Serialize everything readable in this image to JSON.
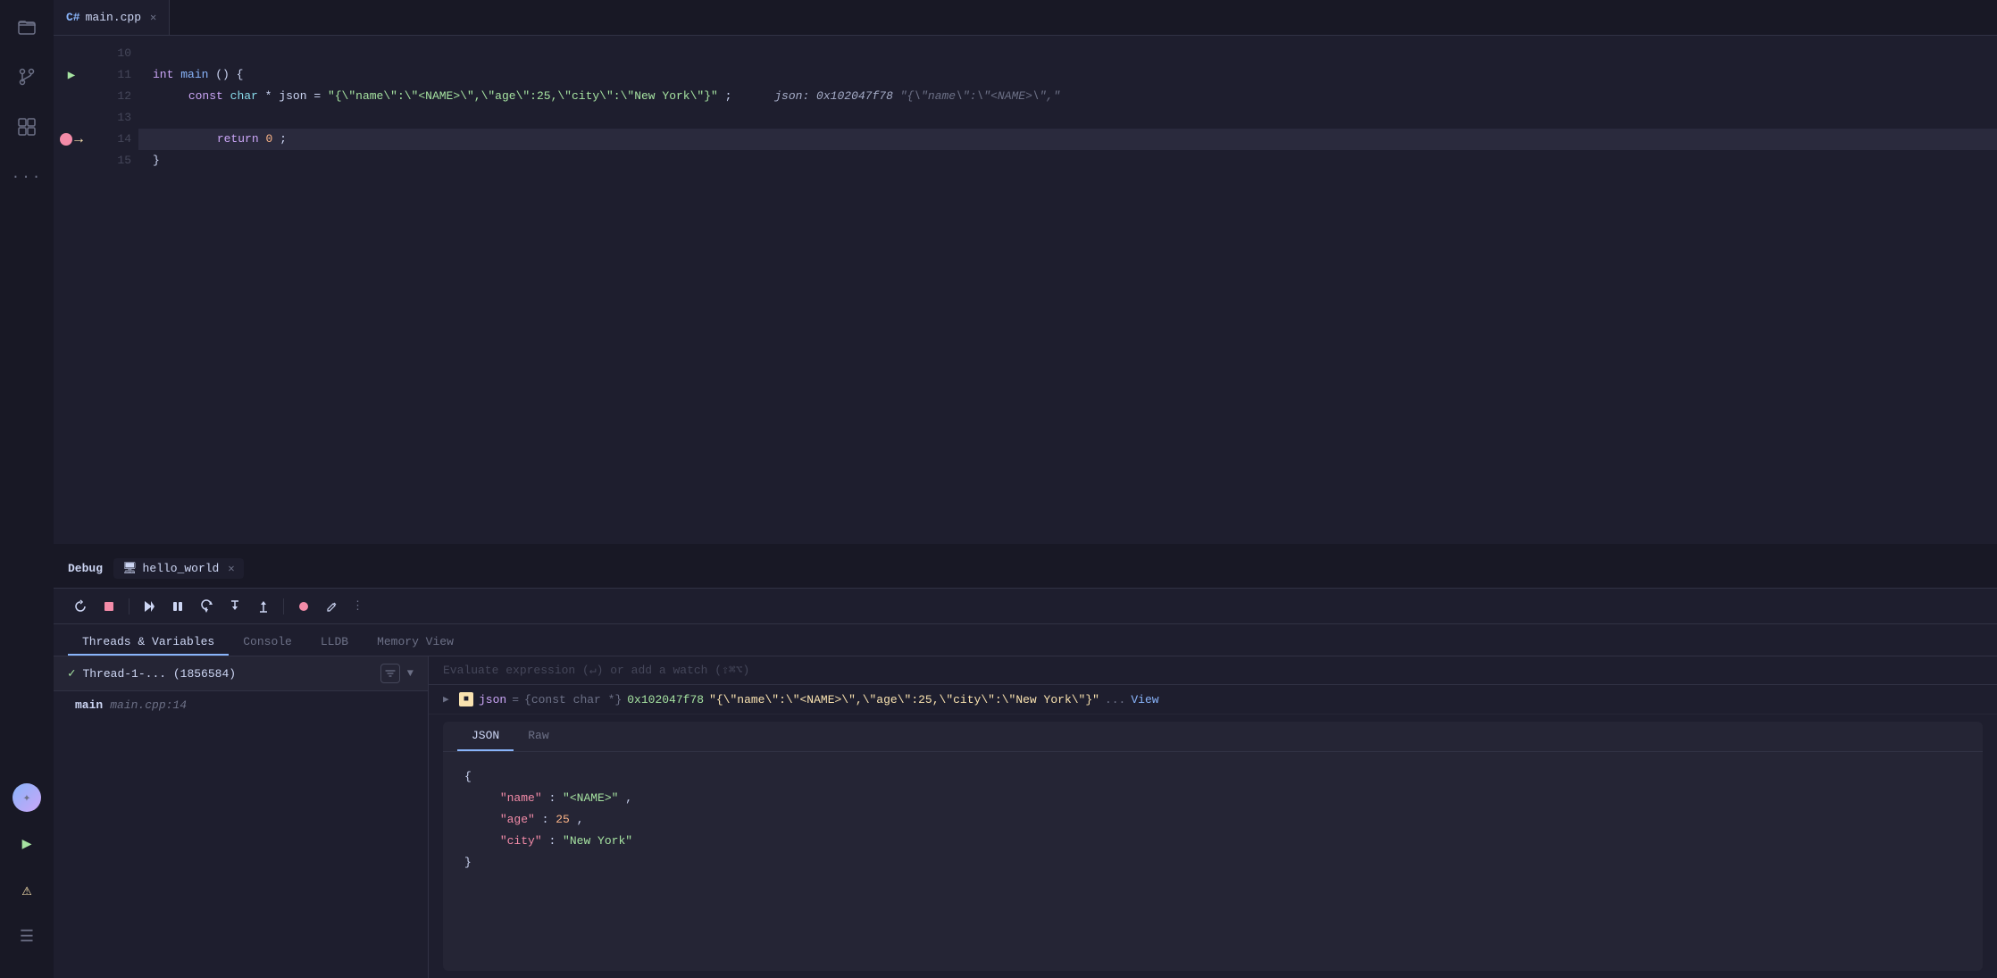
{
  "sidebar": {
    "icons": [
      {
        "name": "folder-icon",
        "symbol": "🗂",
        "active": false
      },
      {
        "name": "source-control-icon",
        "symbol": "⎇",
        "active": false
      },
      {
        "name": "extensions-icon",
        "symbol": "⊞",
        "active": false
      },
      {
        "name": "more-icon",
        "symbol": "···",
        "active": false
      }
    ],
    "bottom": [
      {
        "name": "run-icon",
        "symbol": "▶"
      },
      {
        "name": "warning-icon",
        "symbol": "⚠"
      },
      {
        "name": "menu-icon",
        "symbol": "☰"
      }
    ],
    "avatar": {
      "symbol": "✦"
    }
  },
  "tab_bar": {
    "tabs": [
      {
        "id": "main-cpp-tab",
        "label": "main.cpp",
        "active": true,
        "icon": "C#"
      }
    ]
  },
  "editor": {
    "lines": [
      {
        "number": "10",
        "content": "",
        "type": "empty"
      },
      {
        "number": "11",
        "content": "int main() {",
        "type": "code",
        "has_play": true
      },
      {
        "number": "12",
        "content": "    const char *json = \"{\\\"name\\\":\\\"<NAME>\\\",\\\"age\\\":25,\\\"city\\\":\\\"New York\\\"}\";",
        "type": "code",
        "inline_value": "json: 0x102047f78  \"{\"name\":\"<NAME>\","
      },
      {
        "number": "13",
        "content": "",
        "type": "empty"
      },
      {
        "number": "14",
        "content": "        return 0;",
        "type": "current",
        "has_breakpoint": true,
        "has_arrow": true
      },
      {
        "number": "15",
        "content": "}",
        "type": "code"
      }
    ]
  },
  "debug_panel": {
    "title": "Debug",
    "session_tab": {
      "label": "hello_world",
      "icon": "🖥"
    },
    "toolbar_buttons": [
      {
        "name": "restart-btn",
        "symbol": "↺",
        "title": "Restart"
      },
      {
        "name": "stop-btn",
        "symbol": "■",
        "title": "Stop",
        "red": true
      },
      {
        "name": "continue-btn",
        "symbol": "▷▷",
        "title": "Continue"
      },
      {
        "name": "pause-btn",
        "symbol": "⏸",
        "title": "Pause"
      },
      {
        "name": "step-over-btn",
        "symbol": "↩",
        "title": "Step Over"
      },
      {
        "name": "step-into-btn",
        "symbol": "↓",
        "title": "Step Into"
      },
      {
        "name": "step-out-btn",
        "symbol": "↑",
        "title": "Step Out"
      },
      {
        "name": "breakpoints-btn",
        "symbol": "◎",
        "title": "Breakpoints",
        "red": true
      },
      {
        "name": "edit-btn",
        "symbol": "✎",
        "title": "Edit"
      },
      {
        "name": "more-btn",
        "symbol": "⋮",
        "title": "More"
      }
    ],
    "tabs": [
      {
        "id": "threads-variables-tab",
        "label": "Threads & Variables",
        "active": true
      },
      {
        "id": "console-tab",
        "label": "Console",
        "active": false
      },
      {
        "id": "lldb-tab",
        "label": "LLDB",
        "active": false
      },
      {
        "id": "memory-view-tab",
        "label": "Memory View",
        "active": false
      }
    ],
    "thread": {
      "name": "Thread-1-... (1856584)",
      "checked": true
    },
    "stack_frame": {
      "name": "main",
      "file": "main.cpp:14"
    },
    "watch_placeholder": "Evaluate expression (↵) or add a watch (⇧⌘⌥)",
    "variables": [
      {
        "name": "json",
        "eq": "=",
        "type": "{const char *}",
        "addr": "0x102047f78",
        "value": "{\"name\":\"<NAME>\",\"age\":25,\"city\":\"New York\"}",
        "has_view": true,
        "view_label": "View",
        "ellipsis": "..."
      }
    ],
    "json_viewer": {
      "tabs": [
        {
          "id": "json-tab",
          "label": "JSON",
          "active": true
        },
        {
          "id": "raw-tab",
          "label": "Raw",
          "active": false
        }
      ],
      "content": {
        "name_key": "\"name\"",
        "name_val": "\"<NAME>\"",
        "age_key": "\"age\"",
        "age_val": "25",
        "city_key": "\"city\"",
        "city_val": "\"New York\""
      }
    }
  }
}
